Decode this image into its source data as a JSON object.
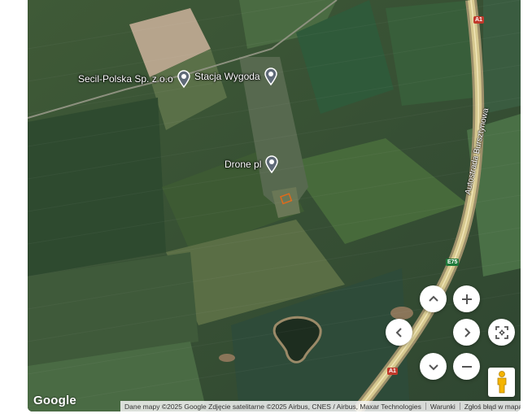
{
  "pois": [
    {
      "id": "secil",
      "label": "Secil-Polska Sp. z o.o"
    },
    {
      "id": "stacja",
      "label": "Stacja Wygoda"
    },
    {
      "id": "drone",
      "label": "Drone pl"
    }
  ],
  "road": {
    "name": "Autostrada Bursztynowa",
    "shield_top": "A1",
    "shield_mid": "E75",
    "shield_bottom": "A1"
  },
  "logo": "Google",
  "footer": {
    "attribution": "Dane mapy ©2025 Google Zdjęcie satelitarne ©2025 Airbus, CNES / Airbus, Maxar Technologies",
    "terms": "Warunki",
    "report": "Zgłoś błąd w mapach"
  },
  "icons": {
    "pin": "place-pin-icon",
    "up": "pan-up-icon",
    "down": "pan-down-icon",
    "left": "pan-left-icon",
    "right": "pan-right-icon",
    "zoom_in": "plus-icon",
    "zoom_out": "minus-icon",
    "recenter": "recenter-icon",
    "pegman": "pegman-icon"
  },
  "colors": {
    "field_dark": "#33492f",
    "field_light": "#56703f",
    "road": "#c9b88a",
    "pin": "#5f6a78"
  }
}
